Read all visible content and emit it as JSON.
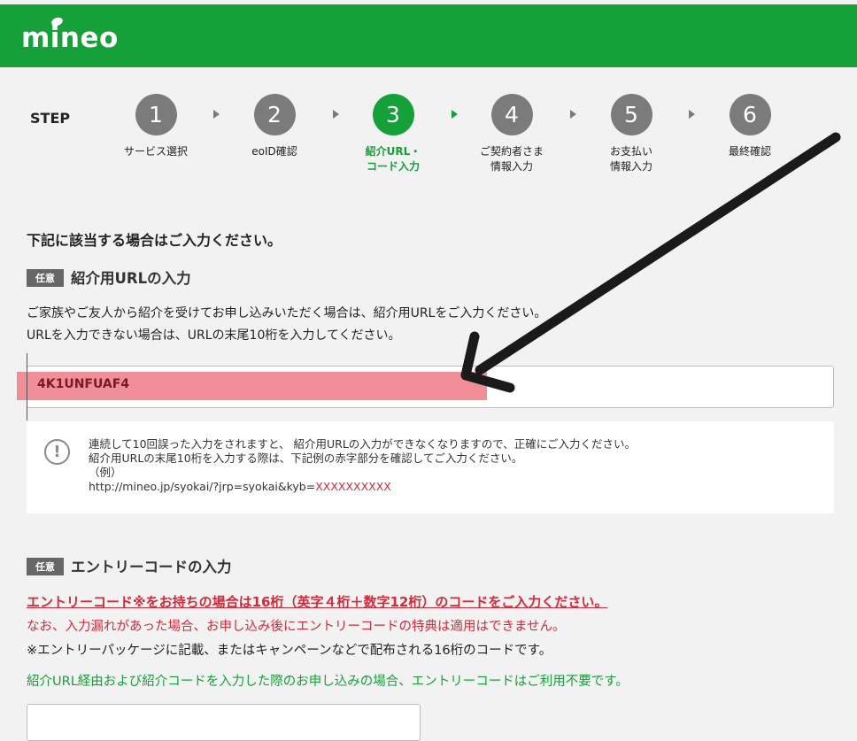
{
  "header": {
    "logo_text": "mineo",
    "brand_color": "#16a03a"
  },
  "steps": {
    "label": "STEP",
    "items": [
      {
        "number": "1",
        "label_line1": "サービス選択",
        "label_line2": ""
      },
      {
        "number": "2",
        "label_line1": "eoID確認",
        "label_line2": ""
      },
      {
        "number": "3",
        "label_line1": "紹介URL・",
        "label_line2": "コード入力",
        "active": true
      },
      {
        "number": "4",
        "label_line1": "ご契約者さま",
        "label_line2": "情報入力"
      },
      {
        "number": "5",
        "label_line1": "お支払い",
        "label_line2": "情報入力"
      },
      {
        "number": "6",
        "label_line1": "最終確認",
        "label_line2": ""
      }
    ]
  },
  "main": {
    "heading": "下記に該当する場合はご入力ください。",
    "referral": {
      "badge": "任意",
      "title": "紹介用URLの入力",
      "desc_line1": "ご家族やご友人から紹介を受けてお申し込みいただく場合は、紹介用URLをご入力ください。",
      "desc_line2": "URLを入力できない場合は、URLの末尾10桁を入力してください。",
      "input_value": "4K1UNFUAF4",
      "notice": {
        "line1": "連続して10回誤った入力をされますと、 紹介用URLの入力ができなくなりますので、正確にご入力ください。",
        "line2": "紹介用URLの末尾10桁を入力する際は、下記例の赤字部分を確認してご入力ください。",
        "line3": "（例）",
        "example_prefix": "http://mineo.jp/syokai/?jrp=syokai&kyb=",
        "example_suffix": "XXXXXXXXXX"
      }
    },
    "entry": {
      "badge": "任意",
      "title": "エントリーコードの入力",
      "red_line1": "エントリーコード※をお持ちの場合は16桁（英字４桁＋数字12桁）のコードをご入力ください。",
      "red_line2": "なお、入力漏れがあった場合、お申し込み後にエントリーコードの特典は適用はできません。",
      "note": "※エントリーパッケージに記載、またはキャンペーンなどで配布される16桁のコードです。",
      "green_note": "紹介URL経由および紹介コードを入力した際のお申し込みの場合、エントリーコードはご利用不要です。",
      "input_value": ""
    }
  }
}
